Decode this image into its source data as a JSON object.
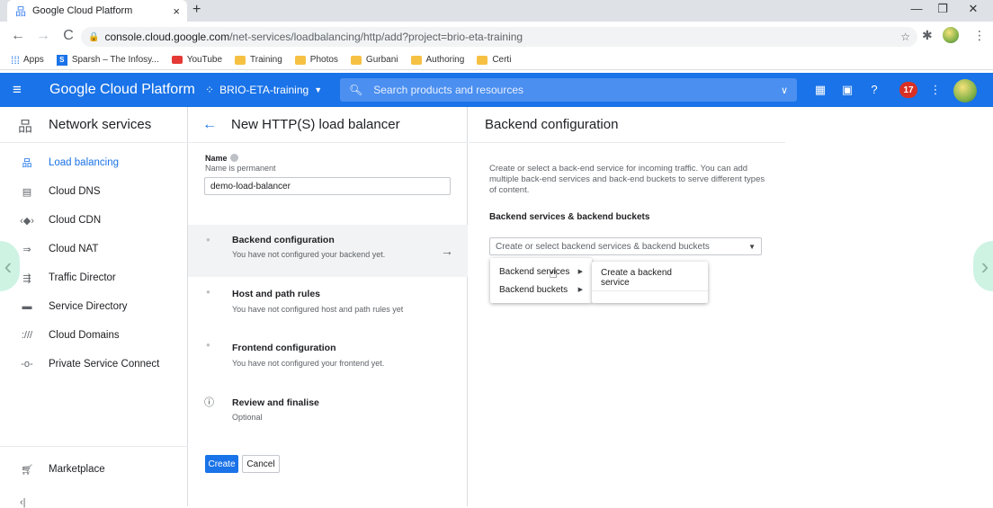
{
  "browser": {
    "tab_title": "Google Cloud Platform",
    "tab_close": "×",
    "new_tab": "+",
    "url_host": "console.cloud.google.com",
    "url_path": "/net-services/loadbalancing/http/add?project=brio-eta-training",
    "win_min": "—",
    "win_restore": "❐",
    "win_close": "✕"
  },
  "bookmarks": [
    {
      "label": "Apps",
      "icon": "apps-grid-icon"
    },
    {
      "label": "Sparsh – The Infosy...",
      "icon": "sparsh-icon"
    },
    {
      "label": "YouTube",
      "icon": "youtube-icon"
    },
    {
      "label": "Training",
      "icon": "folder-icon"
    },
    {
      "label": "Photos",
      "icon": "folder-icon"
    },
    {
      "label": "Gurbani",
      "icon": "folder-icon"
    },
    {
      "label": "Authoring",
      "icon": "folder-icon"
    },
    {
      "label": "Certi",
      "icon": "folder-icon"
    }
  ],
  "header": {
    "title": "Google Cloud Platform",
    "project": "BRIO-ETA-training",
    "search_placeholder": "Search products and resources",
    "notifications": "17",
    "accent": "#1a73e8"
  },
  "sidebar": {
    "title": "Network services",
    "items": [
      {
        "label": "Load balancing",
        "icon": "load-balancing-icon",
        "active": true
      },
      {
        "label": "Cloud DNS",
        "icon": "dns-icon"
      },
      {
        "label": "Cloud CDN",
        "icon": "cdn-icon"
      },
      {
        "label": "Cloud NAT",
        "icon": "nat-icon"
      },
      {
        "label": "Traffic Director",
        "icon": "traffic-director-icon"
      },
      {
        "label": "Service Directory",
        "icon": "service-directory-icon"
      },
      {
        "label": "Cloud Domains",
        "icon": "domains-icon"
      },
      {
        "label": "Private Service Connect",
        "icon": "psc-icon"
      }
    ],
    "marketplace": "Marketplace"
  },
  "middle": {
    "title": "New HTTP(S) load balancer",
    "name_label": "Name",
    "name_hint": "Name is permanent",
    "name_value": "demo-load-balancer",
    "steps": [
      {
        "title": "Backend configuration",
        "desc": "You have not configured your backend yet."
      },
      {
        "title": "Host and path rules",
        "desc": "You have not configured host and path rules yet"
      },
      {
        "title": "Frontend configuration",
        "desc": "You have not configured your frontend yet."
      },
      {
        "title": "Review and finalise",
        "desc": "Optional"
      }
    ],
    "create": "Create",
    "cancel": "Cancel"
  },
  "right": {
    "title": "Backend configuration",
    "description": "Create or select a back-end service for incoming traffic. You can add multiple back-end services and back-end buckets to serve different types of content.",
    "subheading": "Backend services & backend buckets",
    "select_placeholder": "Create or select backend services & backend buckets",
    "menu": [
      "Backend services",
      "Backend buckets"
    ],
    "submenu": [
      "Create a backend service"
    ]
  }
}
